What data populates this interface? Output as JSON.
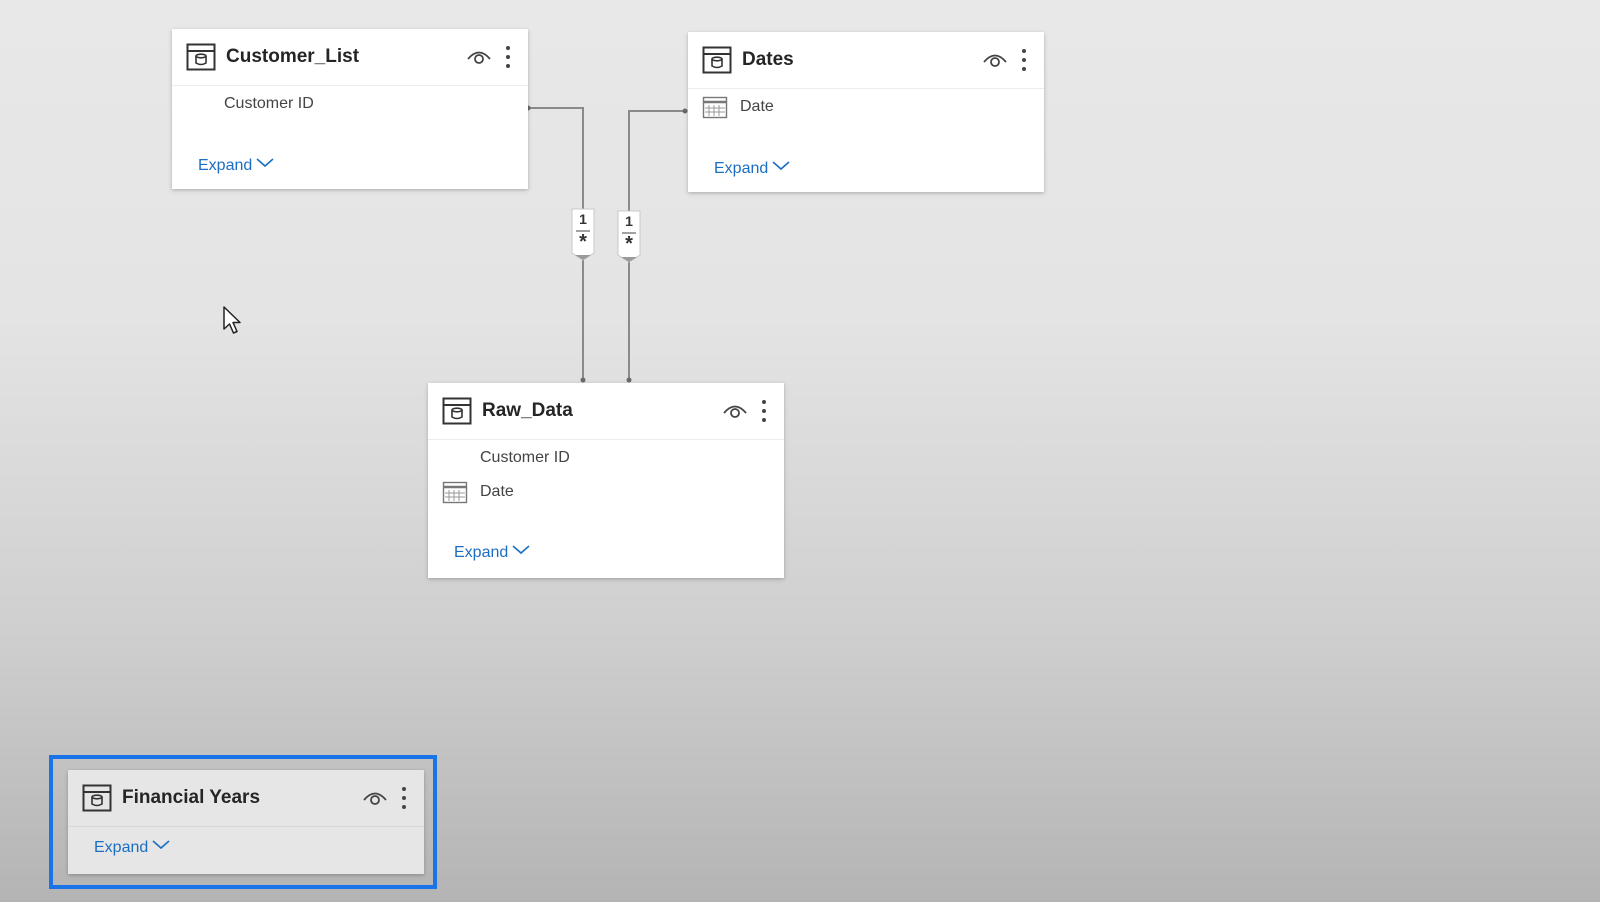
{
  "tables": {
    "customer_list": {
      "title": "Customer_List",
      "fields": [
        "Customer ID"
      ],
      "expand_label": "Expand"
    },
    "dates": {
      "title": "Dates",
      "fields": [
        "Date"
      ],
      "expand_label": "Expand"
    },
    "raw_data": {
      "title": "Raw_Data",
      "fields": [
        "Customer ID",
        "Date"
      ],
      "expand_label": "Expand"
    },
    "financial_years": {
      "title": "Financial Years",
      "expand_label": "Expand"
    }
  },
  "relationships": [
    {
      "from": "Customer_List",
      "to": "Raw_Data",
      "one_side": "1",
      "many_side": "*"
    },
    {
      "from": "Dates",
      "to": "Raw_Data",
      "one_side": "1",
      "many_side": "*"
    }
  ],
  "icons": {
    "table": "table-icon",
    "visibility": "eye-icon",
    "more": "more-options-icon",
    "calendar": "calendar-icon",
    "expand": "chevron-down-icon"
  },
  "colors": {
    "accent_link": "#1b6ec2",
    "selection_border": "#1a73e8"
  }
}
